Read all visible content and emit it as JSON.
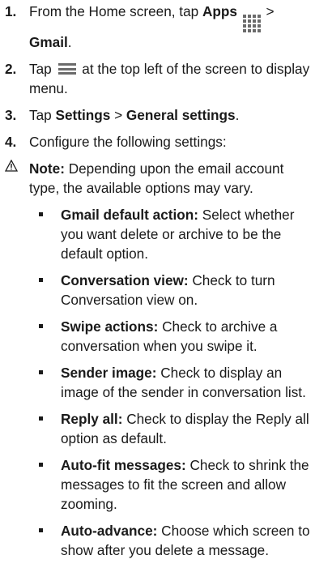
{
  "steps": [
    {
      "num": "1.",
      "pre": "From the Home screen, tap ",
      "bold1": "Apps",
      "mid": " > ",
      "bold2": "Gmail",
      "post": "."
    },
    {
      "num": "2.",
      "pre": "Tap ",
      "post": " at the top left of the screen to display menu."
    },
    {
      "num": "3.",
      "pre": "Tap ",
      "bold1": "Settings",
      "mid": " > ",
      "bold2": "General settings",
      "post": "."
    },
    {
      "num": "4.",
      "text": "Configure the following settings:"
    }
  ],
  "note": {
    "icon": "warning-icon",
    "label": "Note:",
    "text": " Depending upon the email account type, the available options may vary."
  },
  "settings": [
    {
      "name": "Gmail default action:",
      "desc": " Select whether you want delete or archive to be the default option."
    },
    {
      "name": "Conversation view:",
      "desc": " Check to turn Conversation view on."
    },
    {
      "name": "Swipe actions:",
      "desc": " Check to archive a conversation when you swipe it."
    },
    {
      "name": "Sender image:",
      "desc": " Check to display an image of the sender in conversation list."
    },
    {
      "name": "Reply all:",
      "desc": " Check to display the Reply all option as default."
    },
    {
      "name": "Auto-fit messages:",
      "desc": " Check to shrink the messages to fit the screen and allow zooming."
    },
    {
      "name": "Auto-advance:",
      "desc": " Choose which screen to show after you delete a message."
    }
  ],
  "icons": {
    "apps": "apps-grid-icon",
    "menu": "menu-icon",
    "icon_color": "#6b6b6b"
  }
}
